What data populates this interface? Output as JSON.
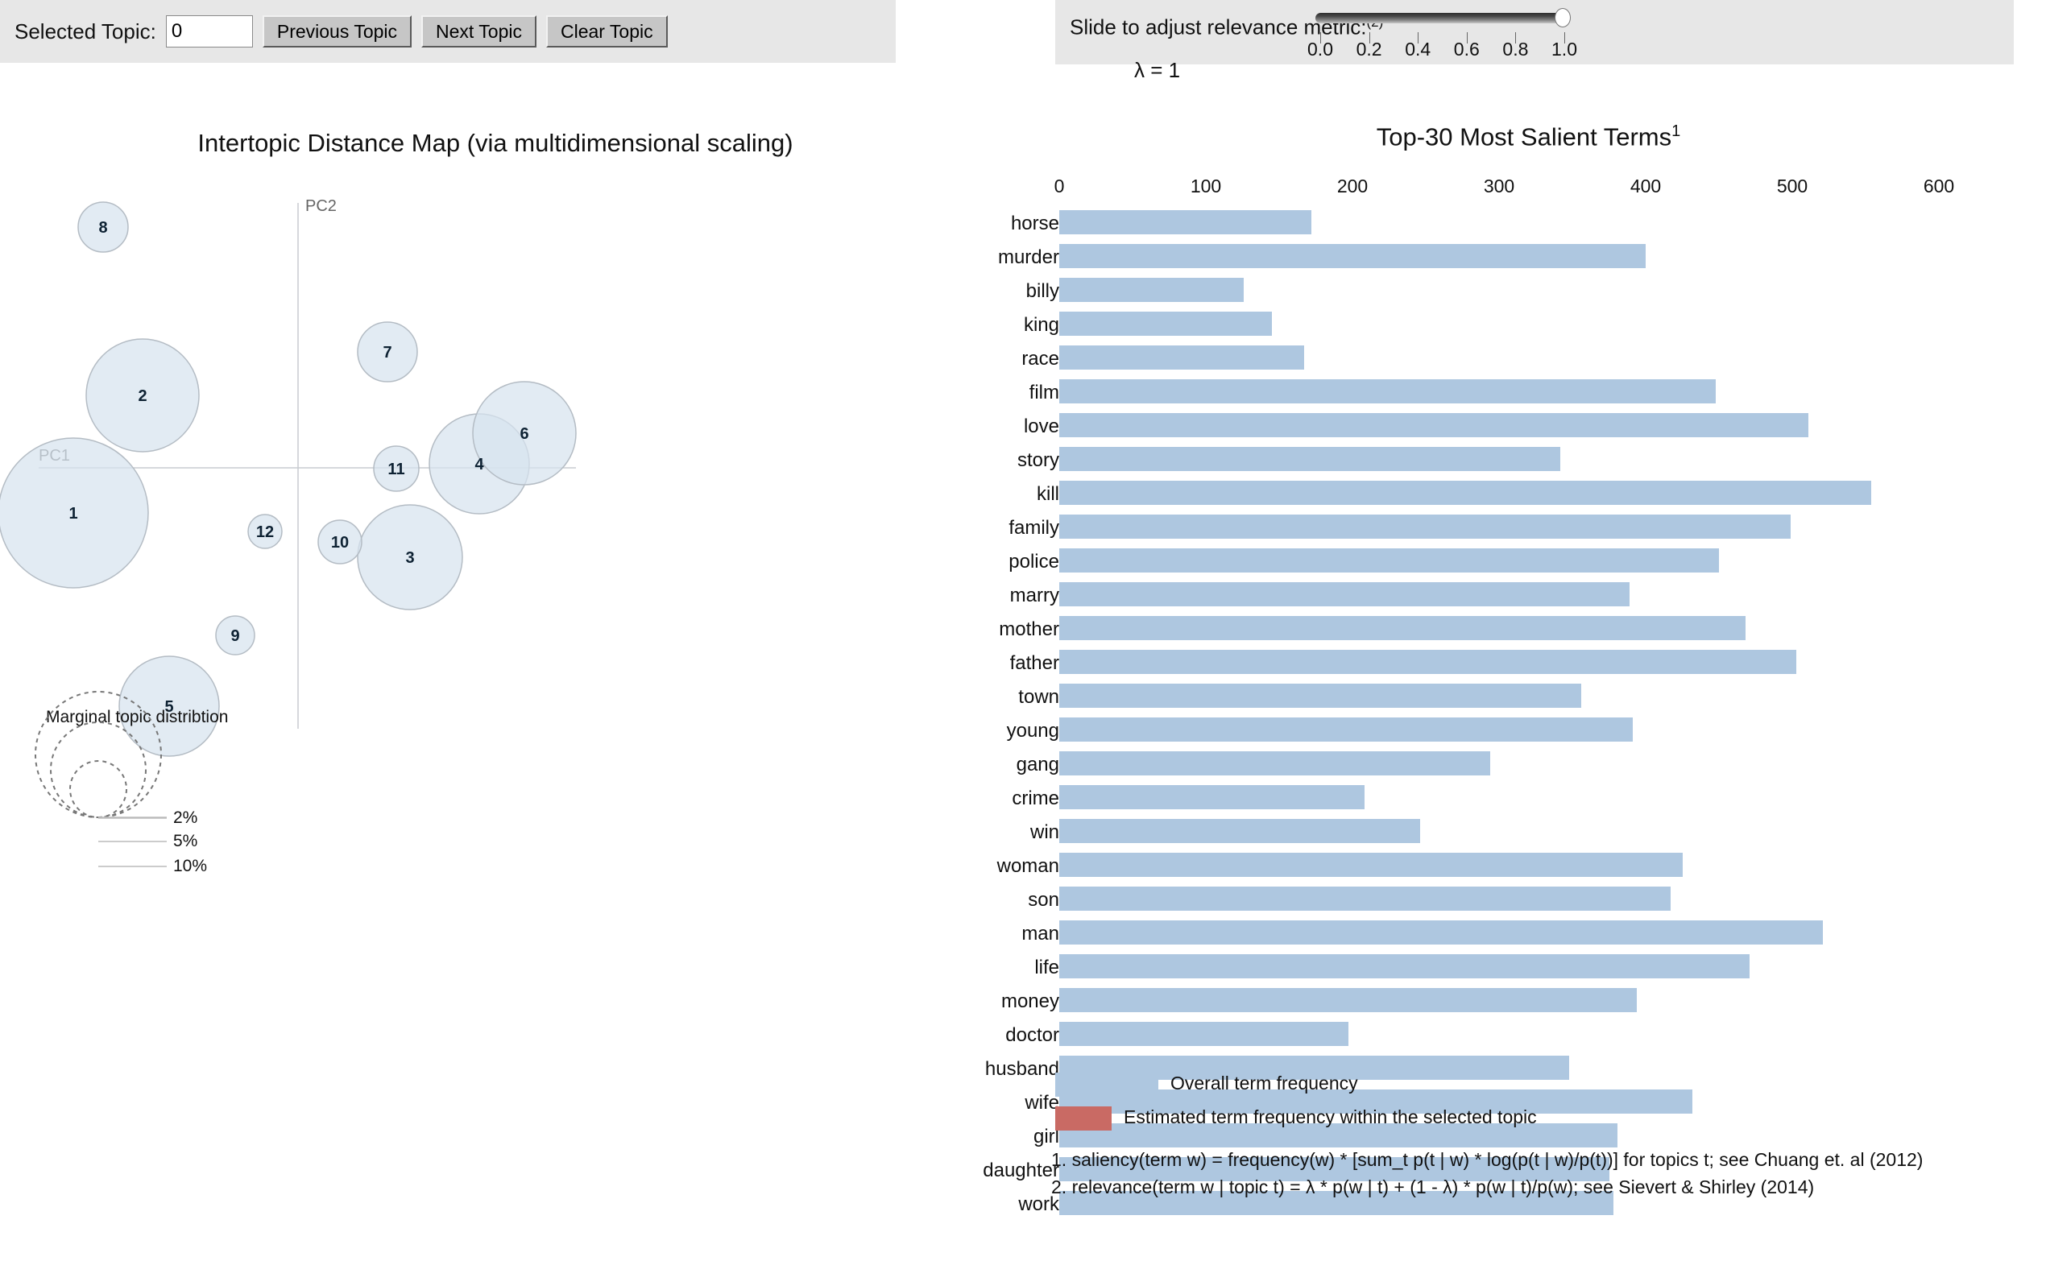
{
  "left_toolbar": {
    "selected_topic_label": "Selected Topic:",
    "topic_value": "0",
    "topic_placeholder": "",
    "previous_button": "Previous Topic",
    "next_button": "Next Topic",
    "clear_button": "Clear Topic"
  },
  "right_toolbar": {
    "slider_caption": "Slide to adjust relevance metric:",
    "slider_caption_sup": "(2)",
    "lambda_label": "λ = 1",
    "slider_value": 1.0,
    "slider_min": 0.0,
    "slider_max": 1.0,
    "tick_labels": [
      "0.0",
      "0.2",
      "0.4",
      "0.6",
      "0.8",
      "1.0"
    ]
  },
  "mds": {
    "title": "Intertopic Distance Map (via multidimensional scaling)",
    "axis_labels": {
      "x": "PC1",
      "y": "PC2"
    },
    "marginal_legend_title": "Marginal topic distribtion",
    "marginal_legend_values": [
      "2%",
      "5%",
      "10%"
    ],
    "circle_fill": "#d7e3ef",
    "circle_stroke": "#b4bcc4",
    "label_color": "#0e2233",
    "topics": [
      {
        "id": "1",
        "cx": 91,
        "cy": 537,
        "r": 93
      },
      {
        "id": "2",
        "cx": 177,
        "cy": 391,
        "r": 70
      },
      {
        "id": "3",
        "cx": 509,
        "cy": 592,
        "r": 65
      },
      {
        "id": "4",
        "cx": 595,
        "cy": 476,
        "r": 62
      },
      {
        "id": "5",
        "cx": 210,
        "cy": 777,
        "r": 62
      },
      {
        "id": "6",
        "cx": 651,
        "cy": 438,
        "r": 64
      },
      {
        "id": "7",
        "cx": 481,
        "cy": 337,
        "r": 37
      },
      {
        "id": "8",
        "cx": 128,
        "cy": 182,
        "r": 31
      },
      {
        "id": "9",
        "cx": 292,
        "cy": 689,
        "r": 24
      },
      {
        "id": "10",
        "cx": 422,
        "cy": 573,
        "r": 27
      },
      {
        "id": "11",
        "cx": 492,
        "cy": 482,
        "r": 28
      },
      {
        "id": "12",
        "cx": 329,
        "cy": 560,
        "r": 21
      }
    ]
  },
  "chart_data": {
    "type": "bar",
    "title": "Top-30 Most Salient Terms",
    "title_superscript": "1",
    "xlabel": "",
    "ylabel": "",
    "xlim": [
      0,
      600
    ],
    "xticks": [
      0,
      100,
      200,
      300,
      400,
      500,
      600
    ],
    "grid": false,
    "orientation": "horizontal",
    "legend_position": "bottom",
    "bar_color": "#aec7e0",
    "highlight_color": "#c96a64",
    "categories": [
      "horse",
      "murder",
      "billy",
      "king",
      "race",
      "film",
      "love",
      "story",
      "kill",
      "family",
      "police",
      "marry",
      "mother",
      "father",
      "town",
      "young",
      "gang",
      "crime",
      "win",
      "woman",
      "son",
      "man",
      "life",
      "money",
      "doctor",
      "husband",
      "wife",
      "girl",
      "daughter",
      "work"
    ],
    "values": [
      172,
      400,
      126,
      145,
      167,
      448,
      511,
      342,
      554,
      499,
      450,
      389,
      468,
      503,
      356,
      391,
      294,
      208,
      246,
      425,
      417,
      521,
      471,
      394,
      197,
      348,
      432,
      381,
      375,
      378
    ],
    "series": [
      {
        "name": "Overall term frequency",
        "values": [
          172,
          400,
          126,
          145,
          167,
          448,
          511,
          342,
          554,
          499,
          450,
          389,
          468,
          503,
          356,
          391,
          294,
          208,
          246,
          425,
          417,
          521,
          471,
          394,
          197,
          348,
          432,
          381,
          375,
          378
        ]
      }
    ],
    "legend": [
      {
        "label": "Overall term frequency",
        "color": "#aec7e0"
      },
      {
        "label": "Estimated term frequency within the selected topic",
        "color": "#c96a64"
      }
    ]
  },
  "footnotes": [
    "1. saliency(term w) = frequency(w) * [sum_t p(t | w) * log(p(t | w)/p(t))] for topics t; see Chuang et. al (2012)",
    "2. relevance(term w | topic t) = λ * p(w | t) + (1 - λ) * p(w | t)/p(w); see Sievert & Shirley (2014)"
  ]
}
